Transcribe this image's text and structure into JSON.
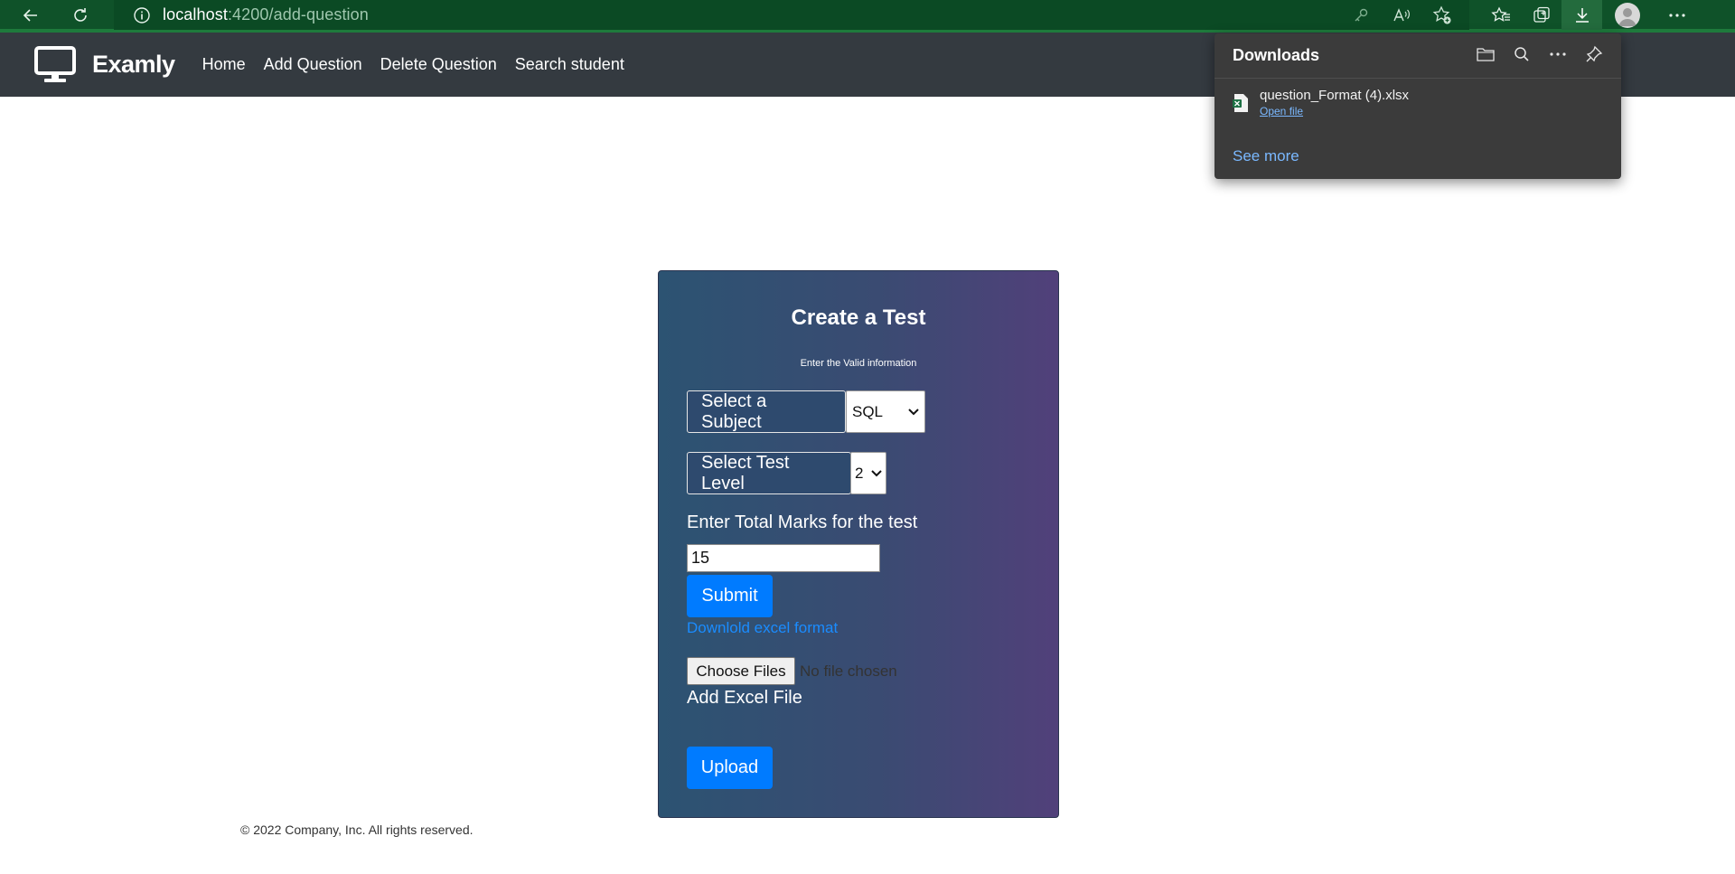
{
  "browser": {
    "url_host": "localhost",
    "url_path": ":4200/add-question"
  },
  "app": {
    "brand": "Examly",
    "nav": [
      {
        "label": "Home"
      },
      {
        "label": "Add Question"
      },
      {
        "label": "Delete Question"
      },
      {
        "label": "Search student"
      }
    ]
  },
  "form": {
    "title": "Create a Test",
    "subtitle": "Enter the Valid information",
    "subject_label": "Select a Subject",
    "subject_value": "SQL",
    "level_label": "Select Test Level",
    "level_value": "2",
    "marks_label": "Enter Total Marks for the test",
    "marks_value": "15",
    "submit_label": "Submit",
    "download_link": "Downlold excel format",
    "choose_files_label": "Choose Files",
    "file_status": "No file chosen",
    "add_excel_label": "Add Excel File",
    "upload_label": "Upload"
  },
  "footer": {
    "text": "© 2022 Company, Inc. All rights reserved."
  },
  "downloads": {
    "title": "Downloads",
    "file_name": "question_Format (4).xlsx",
    "open_file": "Open file",
    "see_more": "See more"
  },
  "colors": {
    "browser_bar": "#0f5229",
    "navbar": "#343a40",
    "primary": "#007bff",
    "card_gradient_start": "#2c5372",
    "card_gradient_end": "#51407a"
  }
}
